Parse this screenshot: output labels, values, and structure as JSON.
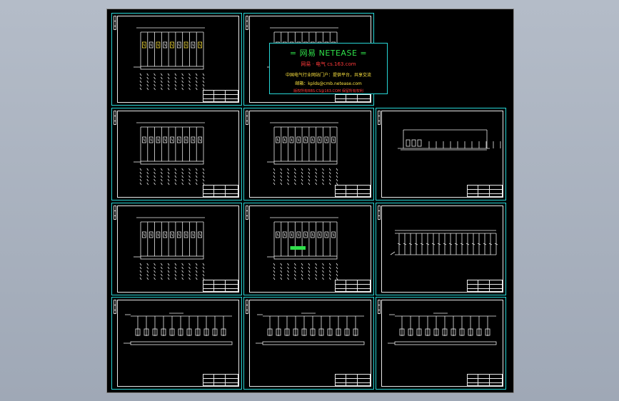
{
  "window": {
    "title": "",
    "colors": {
      "page_background": "#a8b0be",
      "drawing_background": "#000000",
      "sheet_border": "#27d6d6",
      "linework": "#eaeaea",
      "highlight": "#2fe04a"
    }
  },
  "watermark": {
    "title": "= 网易 NETEASE =",
    "line1": "网易 · 电气    cs.163.com",
    "line2": "中国电气行业网站门户：提供平台，共享交流",
    "line3": "邮箱：kplds@cmb.netease.com",
    "line4": "版权所有BBS:CS@163.COM 保留所有权利"
  },
  "sheets": [
    {
      "id": "s1",
      "kind": "panel-a"
    },
    {
      "id": "s2",
      "kind": "panel-b"
    },
    {
      "id": "s3",
      "kind": "panel-a"
    },
    {
      "id": "s4",
      "kind": "panel-b"
    },
    {
      "id": "s5",
      "kind": "rack"
    },
    {
      "id": "s6",
      "kind": "panel-a"
    },
    {
      "id": "s7",
      "kind": "panel-b-highlight"
    },
    {
      "id": "s8",
      "kind": "wide"
    },
    {
      "id": "s9",
      "kind": "busbar"
    },
    {
      "id": "s10",
      "kind": "busbar"
    },
    {
      "id": "s11",
      "kind": "busbar"
    }
  ]
}
